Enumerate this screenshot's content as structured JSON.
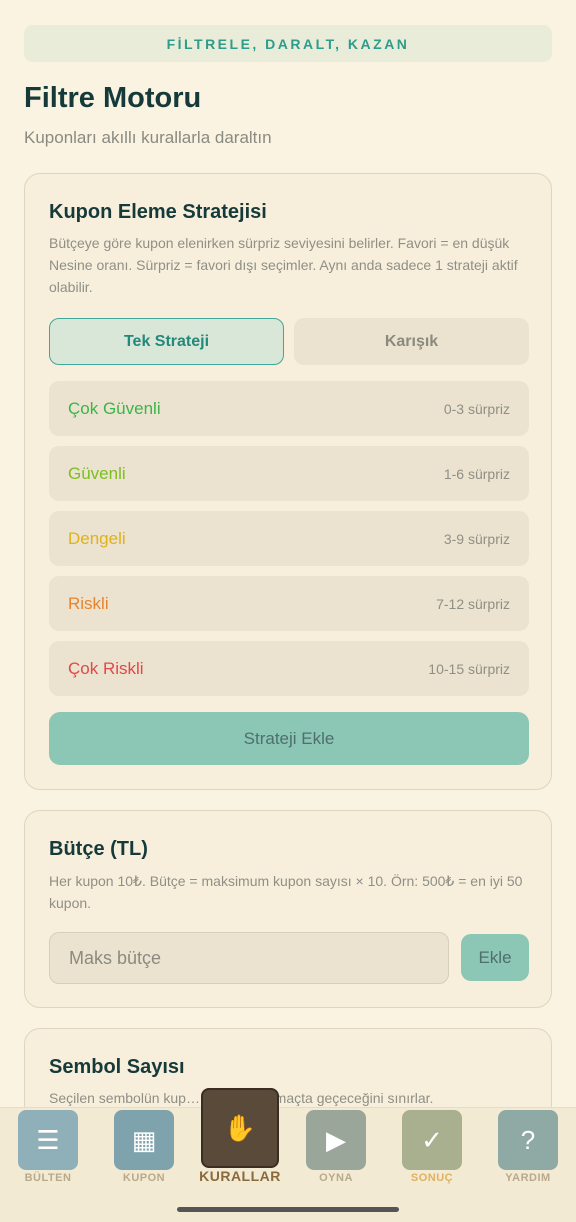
{
  "banner": "FİLTRELE, DARALT, KAZAN",
  "page": {
    "title": "Filtre Motoru",
    "subtitle": "Kuponları akıllı kurallarla daraltın"
  },
  "strategy_card": {
    "title": "Kupon Eleme Stratejisi",
    "description": "Bütçeye göre kupon elenirken sürpriz seviyesini belirler. Favori = en düşük Nesine oranı. Sürpriz = favori dışı seçimler. Aynı anda sadece 1 strateji aktif olabilir.",
    "tabs": [
      {
        "label": "Tek Strateji",
        "active": true
      },
      {
        "label": "Karışık",
        "active": false
      }
    ],
    "options": [
      {
        "label": "Çok Güvenli",
        "range": "0-3 sürpriz",
        "color": "#3bb54a"
      },
      {
        "label": "Güvenli",
        "range": "1-6 sürpriz",
        "color": "#7cbf1e"
      },
      {
        "label": "Dengeli",
        "range": "3-9 sürpriz",
        "color": "#e0b21a"
      },
      {
        "label": "Riskli",
        "range": "7-12 sürpriz",
        "color": "#e8842a"
      },
      {
        "label": "Çok Riskli",
        "range": "10-15 sürpriz",
        "color": "#e0484a"
      }
    ],
    "add_button": "Strateji Ekle"
  },
  "budget_card": {
    "title": "Bütçe (TL)",
    "description": "Her kupon 10₺. Bütçe = maksimum kupon sayısı × 10. Örn: 500₺ = en iyi 50 kupon.",
    "input_placeholder": "Maks bütçe",
    "add_button": "Ekle"
  },
  "symbol_card": {
    "title": "Sembol Sayısı",
    "description": "Seçilen sembolün kup… en çok kaç maçta geçeceğini sınırlar."
  },
  "bottom_nav": [
    {
      "label": "BÜLTEN",
      "icon": "bulletin-icon",
      "active": false
    },
    {
      "label": "KUPON",
      "icon": "coupon-icon",
      "active": false
    },
    {
      "label": "KURALLAR",
      "icon": "rules-icon",
      "active": true
    },
    {
      "label": "OYNA",
      "icon": "play-icon",
      "active": false
    },
    {
      "label": "SONUÇ",
      "icon": "result-icon",
      "active": false
    },
    {
      "label": "YARDIM",
      "icon": "help-icon",
      "active": false
    }
  ]
}
